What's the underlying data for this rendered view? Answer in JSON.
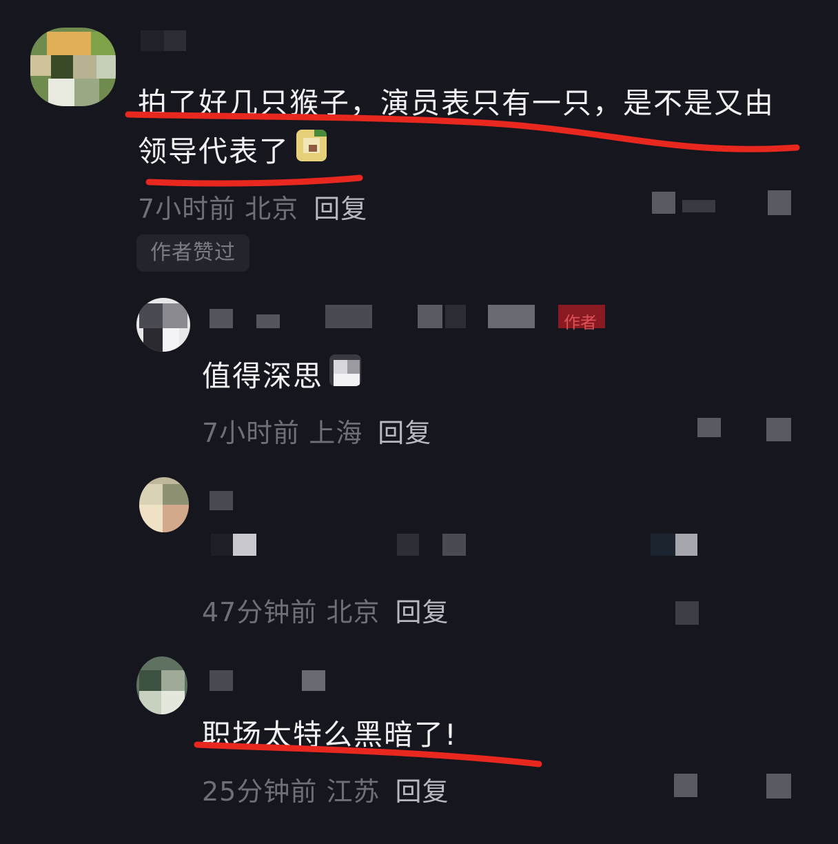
{
  "comments": [
    {
      "text_line1": "拍了好几只猴子，演员表只有一只，是不是又由",
      "text_line2": "领导代表了",
      "time": "7小时前",
      "location": "北京",
      "reply_label": "回复",
      "badge": "作者赞过"
    },
    {
      "text": "值得深思",
      "time": "7小时前",
      "location": "上海",
      "reply_label": "回复",
      "author_tag": "作者"
    },
    {
      "text": "",
      "time": "47分钟前",
      "location": "北京",
      "reply_label": "回复"
    },
    {
      "text": "职场太特么黑暗了!",
      "time": "25分钟前",
      "location": "江苏",
      "reply_label": "回复"
    }
  ],
  "colors": {
    "background": "#16161e",
    "underline": "#e8281e",
    "meta": "#6f6f78",
    "author_tag": "#b8141e"
  }
}
